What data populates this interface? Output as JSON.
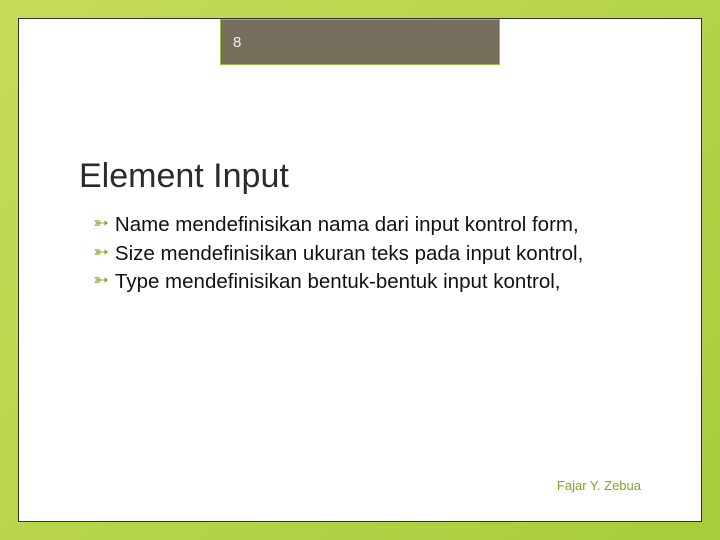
{
  "slide_number": "8",
  "title": "Element Input",
  "bullets": [
    "Name mendefinisikan nama dari input kontrol form,",
    "Size mendefinisikan ukuran teks pada input kontrol,",
    "Type mendefinisikan bentuk-bentuk input kontrol,"
  ],
  "footer": "Fajar Y. Zebua"
}
